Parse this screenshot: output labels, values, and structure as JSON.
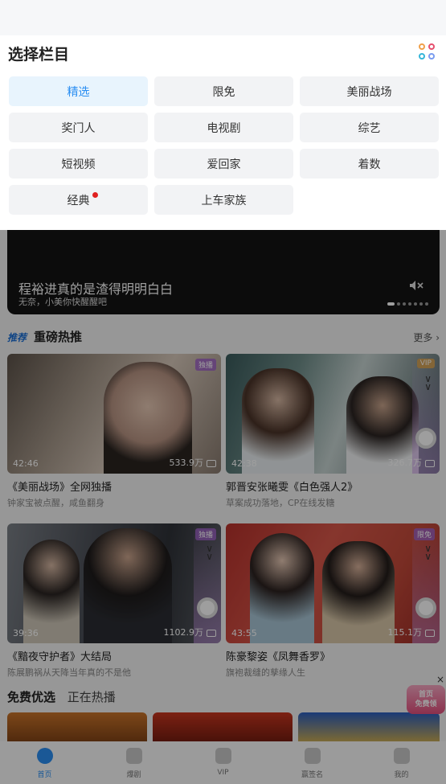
{
  "panel": {
    "title": "选择栏目",
    "chips": [
      {
        "label": "精选",
        "active": true
      },
      {
        "label": "限免"
      },
      {
        "label": "美丽战场"
      },
      {
        "label": "奖门人"
      },
      {
        "label": "电视剧"
      },
      {
        "label": "综艺"
      },
      {
        "label": "短视频"
      },
      {
        "label": "爱回家"
      },
      {
        "label": "着数"
      },
      {
        "label": "经典",
        "dot": true
      },
      {
        "label": "上车家族"
      }
    ]
  },
  "banner": {
    "title": "程裕进真的是渣得明明白白",
    "subtitle": "无奈，小美你快醒醒吧"
  },
  "section": {
    "logo": "推荐",
    "title": "重磅热推",
    "more": "更多"
  },
  "cards": [
    {
      "badge": "独播",
      "duration": "42:46",
      "views": "533.9万",
      "title": "《美丽战场》全网独播",
      "subtitle": "钟家宝被点醒，咸鱼翻身"
    },
    {
      "badge": "VIP",
      "duration": "42:38",
      "views": "326.7万",
      "title": "郭晋安张曦雯《白色强人2》",
      "subtitle": "草案成功落地，CP在线发糖"
    },
    {
      "badge": "独播",
      "duration": "39:36",
      "views": "1102.9万",
      "title": "《黯夜守护者》大结局",
      "subtitle": "陈展鹏祸从天降当年真的不是他"
    },
    {
      "badge": "限免",
      "duration": "43:55",
      "views": "115.1万",
      "title": "陈豪黎姿《凤舞香罗》",
      "subtitle": "旗袍裁缝的孳缘人生"
    }
  ],
  "free": {
    "tab_a": "免费优选",
    "tab_b": "正在热播",
    "gift_label_1": "首页",
    "gift_label_2": "免费领"
  },
  "tabbar": [
    {
      "label": "首页",
      "active": true
    },
    {
      "label": "爆剧"
    },
    {
      "label": "VIP"
    },
    {
      "label": "赢签名"
    },
    {
      "label": "我的"
    }
  ]
}
